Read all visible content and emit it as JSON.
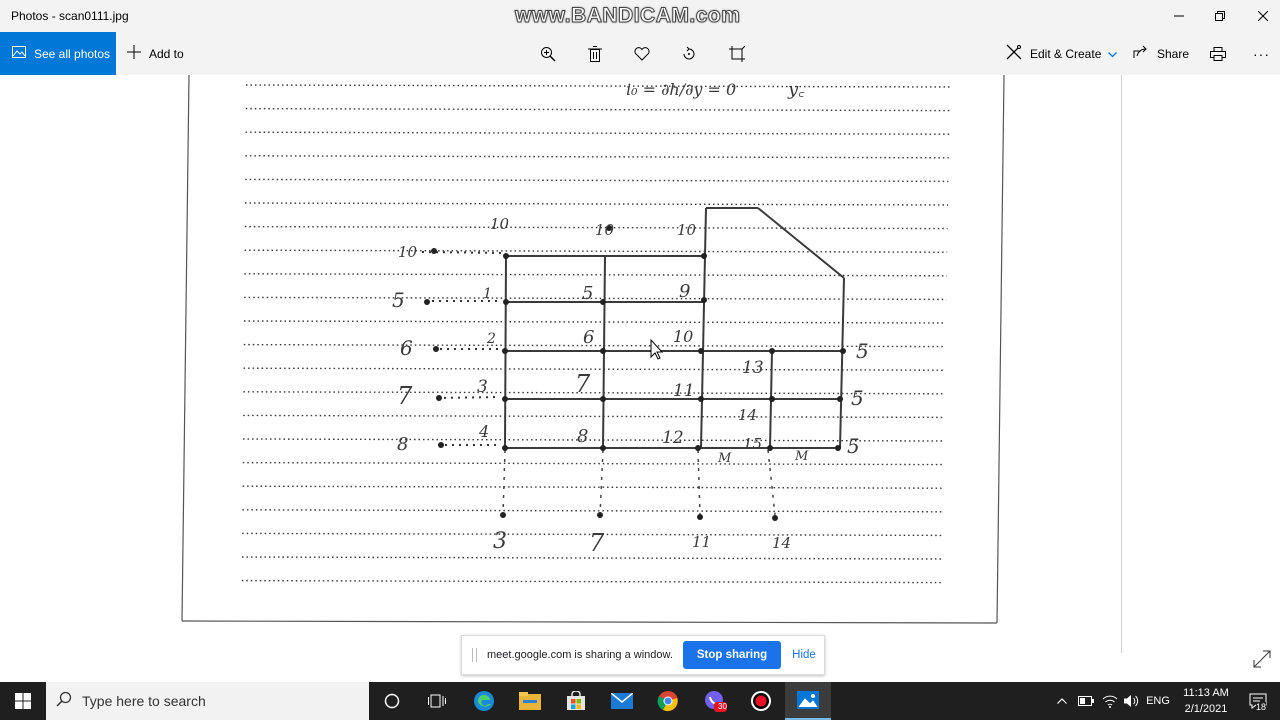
{
  "window": {
    "title": "Photos - scan0111.jpg",
    "watermark": "www.BANDICAM.com"
  },
  "toolbar": {
    "see_all_photos": "See all photos",
    "add_to": "Add to",
    "edit_create": "Edit & Create",
    "share": "Share",
    "more": "···",
    "accent_color": "#0078d7"
  },
  "sketch": {
    "top_formula_left": "i₀ = ∂h/∂y = 0",
    "top_formula_right": "y꜀",
    "top_labels": [
      "10",
      "10",
      "10"
    ],
    "left_labels": [
      "10",
      "5",
      "6",
      "7",
      "8"
    ],
    "right_labels": [
      "5",
      "5",
      "5"
    ],
    "edge_labels": [
      "1",
      "2",
      "3",
      "4"
    ],
    "cell_labels": [
      "5",
      "9",
      "6",
      "10",
      "7",
      "11",
      "13",
      "8",
      "12",
      "14",
      "15"
    ],
    "marks": [
      "M",
      "M"
    ],
    "bottom_labels": [
      "3",
      "7",
      "11",
      "14"
    ]
  },
  "share_banner": {
    "message": "meet.google.com is sharing a window.",
    "stop_label": "Stop sharing",
    "hide_label": "Hide"
  },
  "taskbar": {
    "search_placeholder": "Type here to search",
    "language": "ENG",
    "time": "11:13 AM",
    "date": "2/1/2021",
    "notification_count": "18",
    "viber_badge": "30"
  }
}
